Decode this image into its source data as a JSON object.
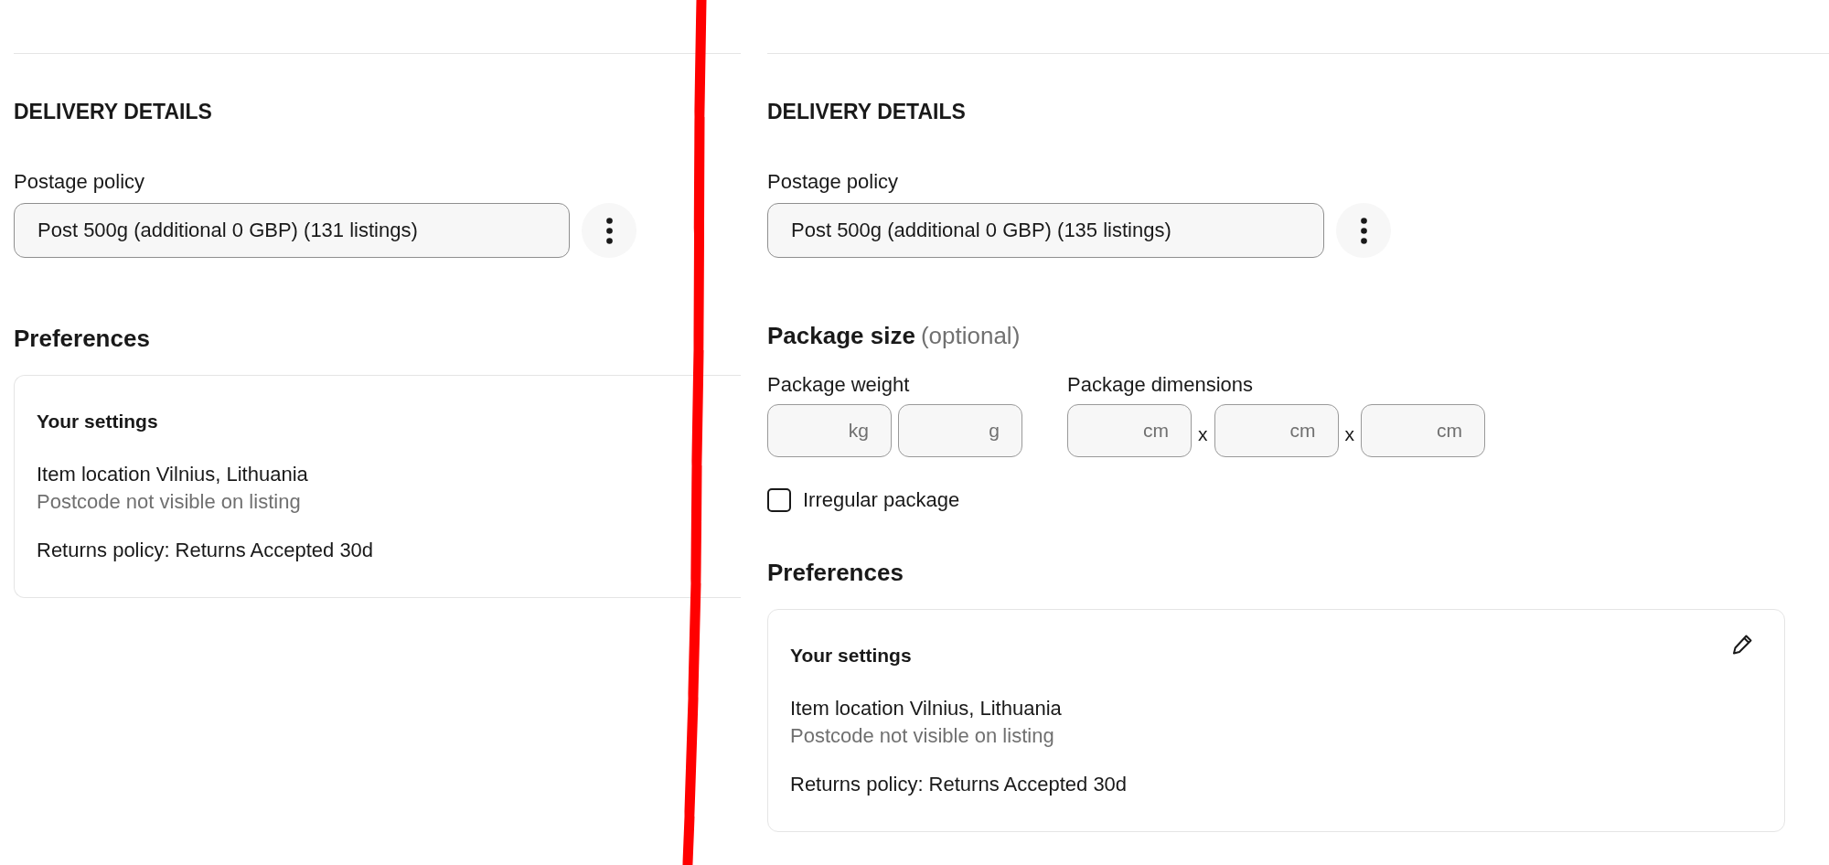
{
  "panels": [
    {
      "heading": "DELIVERY DETAILS",
      "postage_policy": {
        "label": "Postage policy",
        "value": "Post 500g (additional 0 GBP) (131 listings)"
      },
      "preferences": {
        "heading": "Preferences",
        "card": {
          "title": "Your settings",
          "location": "Item location Vilnius, Lithuania",
          "postcode_note": "Postcode not visible on listing",
          "returns_policy": "Returns policy: Returns Accepted 30d"
        }
      }
    },
    {
      "heading": "DELIVERY DETAILS",
      "postage_policy": {
        "label": "Postage policy",
        "value": "Post 500g (additional 0 GBP) (135 listings)"
      },
      "package_size": {
        "heading": "Package size",
        "note": "(optional)",
        "weight": {
          "label": "Package weight",
          "fields": [
            {
              "unit": "kg"
            },
            {
              "unit": "g"
            }
          ]
        },
        "dimensions": {
          "label": "Package dimensions",
          "fields": [
            {
              "unit": "cm"
            },
            {
              "unit": "cm"
            },
            {
              "unit": "cm"
            }
          ],
          "separators": [
            "x",
            "x"
          ]
        },
        "irregular": {
          "label": "Irregular package",
          "checked": false
        }
      },
      "preferences": {
        "heading": "Preferences",
        "card": {
          "title": "Your settings",
          "editable": true,
          "location": "Item location Vilnius, Lithuania",
          "postcode_note": "Postcode not visible on listing",
          "returns_policy": "Returns policy: Returns Accepted 30d"
        }
      }
    }
  ]
}
